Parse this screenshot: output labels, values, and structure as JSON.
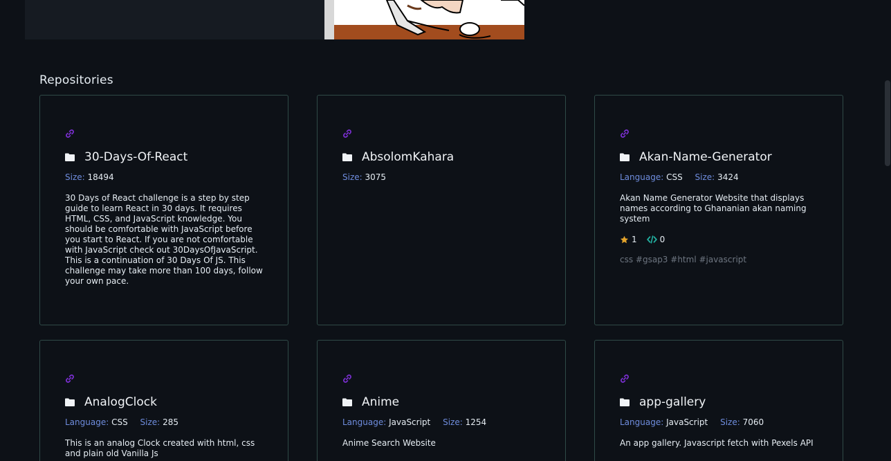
{
  "section_title": "Repositories",
  "colors": {
    "background": "#0d1117",
    "card_border": "#2f4a47",
    "label_blue": "#6f8dde",
    "link_icon_purple": "#7a2fd0",
    "star_gold": "#e3a32b",
    "code_teal": "#22b0a0",
    "topics_gray": "#6e7681"
  },
  "labels": {
    "language": "Language:",
    "size": "Size:"
  },
  "repos": [
    {
      "name": "30-Days-Of-React",
      "size": "18494",
      "description": "30 Days of React challenge is a step by step guide to learn React in 30 days. It requires HTML, CSS, and JavaScript knowledge. You should be comfortable with JavaScript before you start to React. If you are not comfortable with JavaScript check out 30DaysOfJavaScript. This is a continuation of 30 Days Of JS. This challenge may take more than 100 days, follow your own pace."
    },
    {
      "name": "AbsolomKahara",
      "size": "3075"
    },
    {
      "name": "Akan-Name-Generator",
      "language": "CSS",
      "size": "3424",
      "description": "Akan Name Generator Website that displays names according to Ghananian akan naming system",
      "stars": "1",
      "forks": "0",
      "topics": "css #gsap3 #html #javascript"
    },
    {
      "name": "AnalogClock",
      "language": "CSS",
      "size": "285",
      "description": "This is an analog Clock created with html, css and plain old Vanilla Js"
    },
    {
      "name": "Anime",
      "language": "JavaScript",
      "size": "1254",
      "description": "Anime Search Website"
    },
    {
      "name": "app-gallery",
      "language": "JavaScript",
      "size": "7060",
      "description": "An app gallery. Javascript fetch with Pexels API"
    }
  ]
}
